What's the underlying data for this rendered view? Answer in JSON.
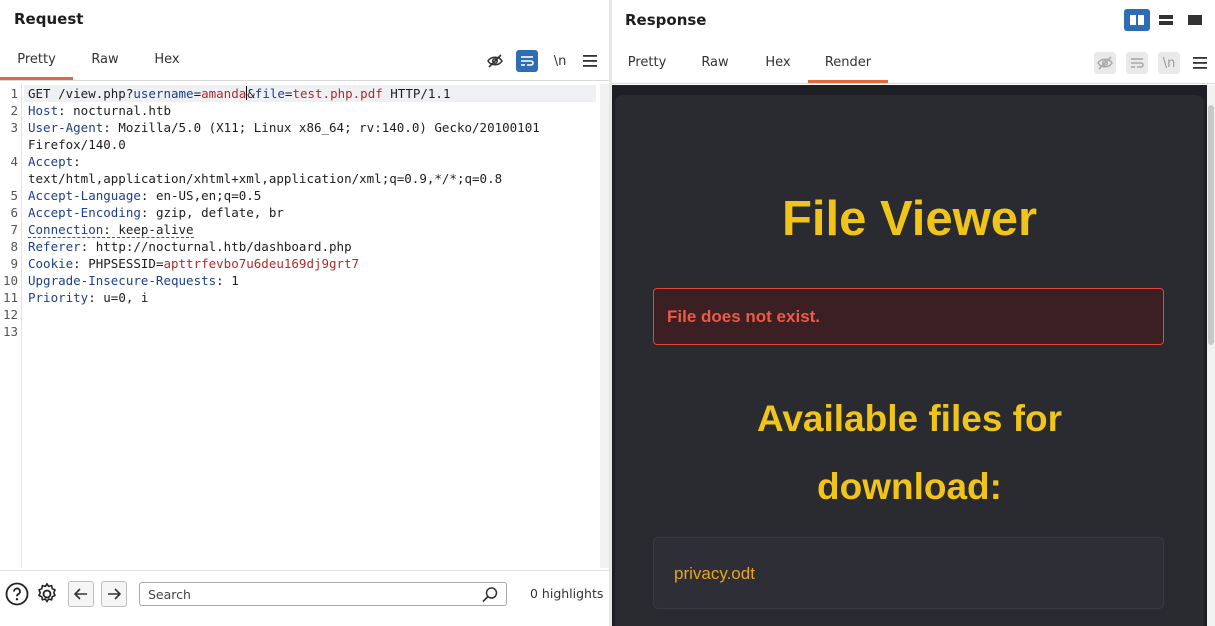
{
  "request": {
    "title": "Request",
    "tabs": [
      "Pretty",
      "Raw",
      "Hex"
    ],
    "active_tab": "Pretty",
    "toolbar": {
      "newline_label": "\\n"
    },
    "lines": [
      {
        "n": "1",
        "method": "GET /view.php?",
        "k1": "username",
        "eq1": "=",
        "v1": "amanda",
        "amp": "&",
        "k2": "file",
        "eq2": "=",
        "v2": "test.php.pdf",
        "tail": " HTTP/1.1"
      },
      {
        "n": "2",
        "key": "Host",
        "val": ": nocturnal.htb"
      },
      {
        "n": "3",
        "key": "User-Agent",
        "val": ": Mozilla/5.0 (X11; Linux x86_64; rv:140.0) Gecko/20100101"
      },
      {
        "n": "",
        "cont": "Firefox/140.0"
      },
      {
        "n": "4",
        "key": "Accept",
        "val": ":"
      },
      {
        "n": "",
        "cont": "text/html,application/xhtml+xml,application/xml;q=0.9,*/*;q=0.8"
      },
      {
        "n": "5",
        "key": "Accept-Language",
        "val": ": en-US,en;q=0.5"
      },
      {
        "n": "6",
        "key": "Accept-Encoding",
        "val": ": gzip, deflate, br"
      },
      {
        "n": "7",
        "key": "Connection",
        "val": ": keep-alive"
      },
      {
        "n": "8",
        "key": "Referer",
        "val": ": http://nocturnal.htb/dashboard.php"
      },
      {
        "n": "9",
        "key": "Cookie",
        "val": ": PHPSESSID=",
        "cookie_val": "apttrfevbo7u6deu169dj9grt7"
      },
      {
        "n": "10",
        "key": "Upgrade-Insecure-Requests",
        "val": ": 1"
      },
      {
        "n": "11",
        "key": "Priority",
        "val": ": u=0, i"
      },
      {
        "n": "12"
      },
      {
        "n": "13"
      }
    ],
    "search": {
      "placeholder": "Search",
      "highlights": "0 highlights"
    }
  },
  "response": {
    "title": "Response",
    "tabs": [
      "Pretty",
      "Raw",
      "Hex",
      "Render"
    ],
    "active_tab": "Render",
    "toolbar": {
      "newline_label": "\\n"
    },
    "page": {
      "heading": "File Viewer",
      "error": "File does not exist.",
      "available_line1": "Available files for",
      "available_line2": "download:",
      "files": [
        "privacy.odt"
      ]
    }
  },
  "colors": {
    "accent_tab": "#e0693e",
    "button_blue": "#2c6db5",
    "render_bg": "#2a2b31",
    "heading_yellow": "#f0c419",
    "error_red": "#ec5a4a"
  }
}
